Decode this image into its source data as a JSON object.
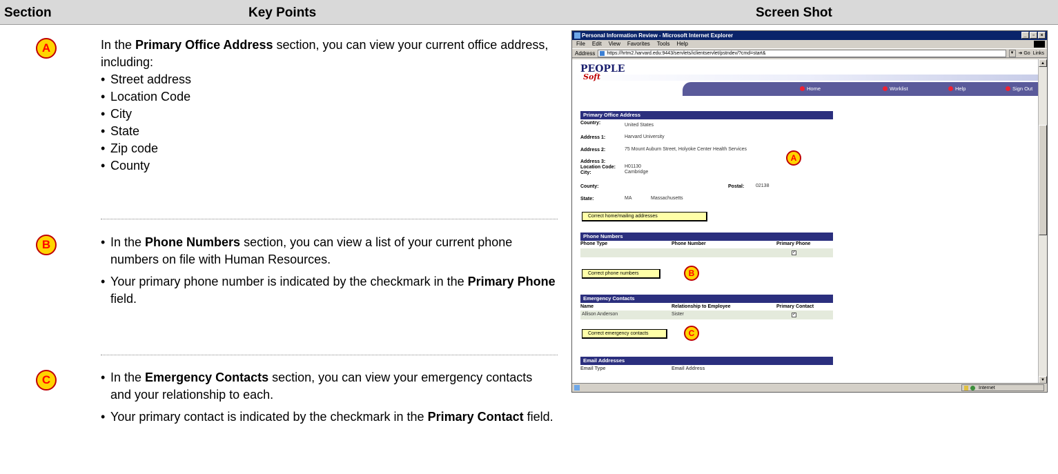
{
  "headers": {
    "section": "Section",
    "key_points": "Key Points",
    "screen_shot": "Screen Shot"
  },
  "rows": [
    {
      "badge": "A",
      "intro_pre": "In the ",
      "intro_bold": "Primary Office Address",
      "intro_post": " section, you can view your current office address, including:",
      "bullets": [
        "Street address",
        "Location Code",
        "City",
        "State",
        "Zip code",
        "County"
      ]
    },
    {
      "badge": "B",
      "b1_pre": "In the ",
      "b1_bold": "Phone Numbers",
      "b1_post": " section, you can view a list of your current phone numbers on file with Human Resources.",
      "b2_pre": "Your primary phone number is indicated by the checkmark in the ",
      "b2_bold": "Primary Phone",
      "b2_post": " field."
    },
    {
      "badge": "C",
      "b1_pre": "In the ",
      "b1_bold": "Emergency Contacts",
      "b1_post": " section, you can view your emergency contacts and your relationship to each.",
      "b2_pre": "Your primary contact is indicated by the checkmark in the ",
      "b2_bold": "Primary Contact",
      "b2_post": " field."
    }
  ],
  "browser": {
    "title": "Personal Information Review - Microsoft Internet Explorer",
    "menu": [
      "File",
      "Edit",
      "View",
      "Favorites",
      "Tools",
      "Help"
    ],
    "address_label": "Address",
    "url": "https://hrtm2.harvard.edu:9443/servlets/iclientservlet/pstndev/?cmd=start&",
    "go": "Go",
    "links": "Links",
    "status_zone": "Internet",
    "logo_top": "PEOPLE",
    "logo_bottom": "Soft",
    "nav": [
      "Home",
      "Worklist",
      "Help",
      "Sign Out"
    ],
    "office": {
      "header": "Primary Office Address",
      "country_label": "Country:",
      "country": "United States",
      "addr1_label": "Address 1:",
      "addr1": "Harvard University",
      "addr2_label": "Address 2:",
      "addr2": "75 Mount Auburn Street, Holyoke Center Health Services",
      "addr3_label": "Address 3:",
      "loc_label": "Location Code:",
      "loc": "H01130",
      "city_label": "City:",
      "city": "Cambridge",
      "county_label": "County:",
      "postal_label": "Postal:",
      "postal": "02138",
      "state_label": "State:",
      "state": "MA",
      "state_name": "Massachusetts",
      "button": "Correct home/mailing addresses"
    },
    "phones": {
      "header": "Phone Numbers",
      "cols": [
        "Phone Type",
        "Phone Number",
        "Primary Phone"
      ],
      "button": "Correct phone numbers"
    },
    "emergency": {
      "header": "Emergency Contacts",
      "cols": [
        "Name",
        "Relationship to Employee",
        "Primary Contact"
      ],
      "name": "Allison Anderson",
      "relationship": "Sister",
      "button": "Correct emergency contacts"
    },
    "email": {
      "header": "Email Addresses",
      "cols": [
        "Email Type",
        "Email Address"
      ]
    }
  }
}
